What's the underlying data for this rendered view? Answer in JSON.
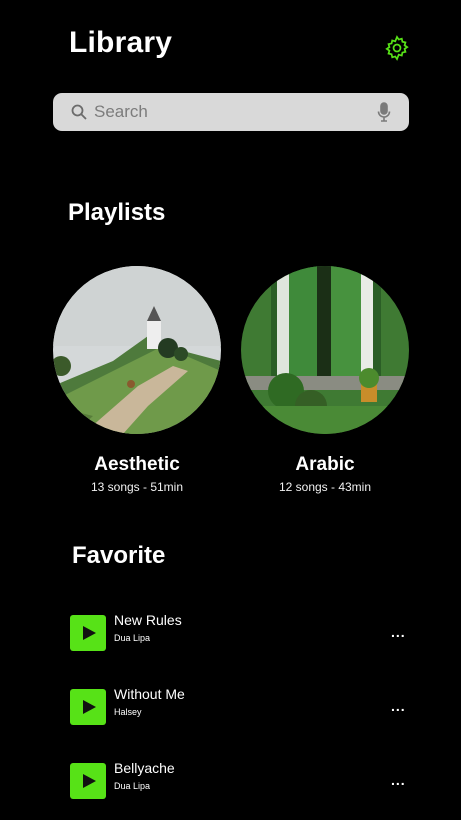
{
  "header": {
    "title": "Library",
    "settings_icon": "gear-icon",
    "accent": "#57e217"
  },
  "search": {
    "placeholder": "Search",
    "value": "",
    "search_icon": "search-icon",
    "mic_icon": "microphone-icon"
  },
  "playlists": {
    "heading": "Playlists",
    "items": [
      {
        "name": "Aesthetic",
        "meta": "13 songs - 51min"
      },
      {
        "name": "Arabic",
        "meta": "12 songs - 43min"
      }
    ]
  },
  "favorite": {
    "heading": "Favorite",
    "items": [
      {
        "title": "New Rules",
        "artist": "Dua Lipa"
      },
      {
        "title": "Without Me",
        "artist": "Halsey"
      },
      {
        "title": "Bellyache",
        "artist": "Dua Lipa"
      }
    ],
    "more_glyph": "..."
  }
}
